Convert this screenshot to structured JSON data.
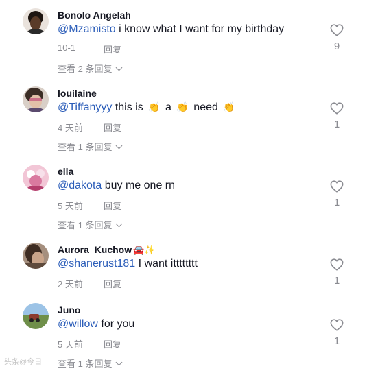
{
  "comments": [
    {
      "username": "Bonolo Angelah",
      "username_emoji": "",
      "mention": "@Mzamisto",
      "text": " i know what I want for my birthday",
      "date": "10-1",
      "reply_label": "回复",
      "view_replies": "查看 2 条回复",
      "likes": "9",
      "avatar_colors": [
        "#3a2a20",
        "#6b4a35"
      ]
    },
    {
      "username": "louilaine",
      "username_emoji": "",
      "mention": "@Tiffanyyy",
      "text_parts": [
        " this is ",
        " a ",
        " need "
      ],
      "clap_emoji": "👏",
      "date": "4 天前",
      "reply_label": "回复",
      "view_replies": "查看 1 条回复",
      "likes": "1",
      "avatar_colors": [
        "#5b4636",
        "#d8b8a0"
      ]
    },
    {
      "username": "ella",
      "username_emoji": "",
      "mention": "@dakota",
      "text": " buy me one rn",
      "date": "5 天前",
      "reply_label": "回复",
      "view_replies": "查看 1 条回复",
      "likes": "1",
      "avatar_colors": [
        "#e6a3c0",
        "#c2567f"
      ]
    },
    {
      "username": "Aurora_Kuchow",
      "username_emoji": "🚘✨",
      "mention": "@shanerust181",
      "text": " I want itttttttt",
      "date": "2 天前",
      "reply_label": "回复",
      "view_replies": "",
      "likes": "1",
      "avatar_colors": [
        "#4a3a30",
        "#8c6e58"
      ]
    },
    {
      "username": "Juno",
      "username_emoji": "",
      "mention": "@willow",
      "text": " for you",
      "date": "5 天前",
      "reply_label": "回复",
      "view_replies": "查看 1 条回复",
      "likes": "1",
      "avatar_colors": [
        "#8ab0d8",
        "#6d8a4a"
      ]
    }
  ],
  "watermark": "头条@今日",
  "colors": {
    "mention": "#2b5db9",
    "text": "#161823",
    "meta": "#8a8b91"
  }
}
